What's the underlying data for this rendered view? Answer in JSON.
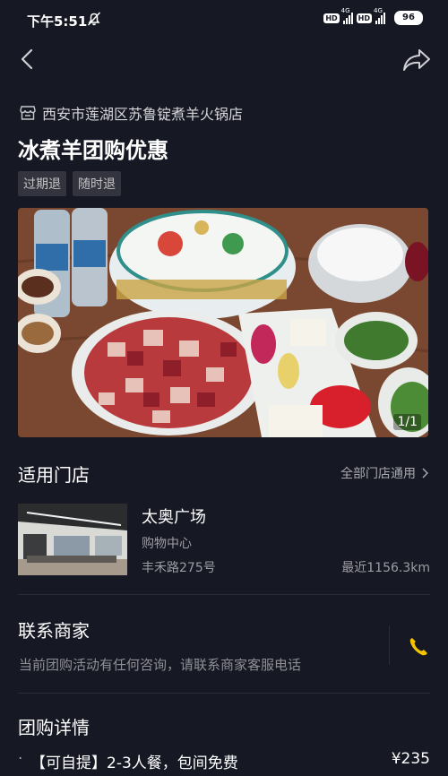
{
  "status": {
    "time": "下午5:51",
    "hd": "HD",
    "net": "4G",
    "battery": "96"
  },
  "shop": {
    "name": "西安市莲湖区苏鲁锭煮羊火锅店"
  },
  "deal": {
    "title": "冰煮羊团购优惠",
    "tags": [
      "过期退",
      "随时退"
    ]
  },
  "photo": {
    "counter": "1/1"
  },
  "stores": {
    "header": "适用门店",
    "all_label": "全部门店通用",
    "item": {
      "name": "太奥广场",
      "type": "购物中心",
      "address": "丰禾路275号",
      "distance": "最近1156.3km"
    }
  },
  "contact": {
    "header": "联系商家",
    "description": "当前团购活动有任何咨询，请联系商家客服电话"
  },
  "details": {
    "header": "团购详情",
    "items": [
      {
        "bullet": "·",
        "name": "【可自提】2-3人餐，包间免费",
        "price": "¥235"
      }
    ]
  },
  "colors": {
    "background": "#161823",
    "phone_icon": "#f5c400"
  }
}
